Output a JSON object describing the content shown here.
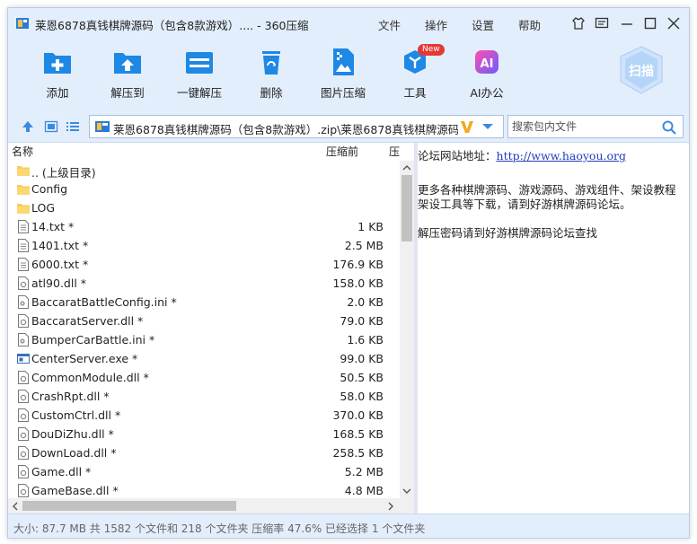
{
  "window": {
    "title": "莱恩6878真钱棋牌源码（包含8款游戏）.... - 360压缩",
    "menu": [
      "文件",
      "操作",
      "设置",
      "帮助"
    ]
  },
  "toolbar": {
    "tools": [
      {
        "label": "添加",
        "icon": "add-icon"
      },
      {
        "label": "解压到",
        "icon": "extract-to-icon"
      },
      {
        "label": "一键解压",
        "icon": "one-click-extract-icon"
      },
      {
        "label": "删除",
        "icon": "delete-icon"
      },
      {
        "label": "图片压缩",
        "icon": "image-compress-icon"
      },
      {
        "label": "工具",
        "icon": "tools-icon",
        "badge": "New"
      },
      {
        "label": "AI办公",
        "icon": "ai-office-icon",
        "glyph": "AI"
      }
    ],
    "scan_label": "扫描"
  },
  "address": {
    "path": "莱恩6878真钱棋牌源码（包含8款游戏）.zip\\莱恩6878真钱棋牌源码（包",
    "search_placeholder": "搜索包内文件"
  },
  "columns": {
    "name": "名称",
    "size_before": "压缩前",
    "ratio": "压"
  },
  "files": [
    {
      "name": ".. (上级目录)",
      "size": "",
      "type": "folder"
    },
    {
      "name": "Config",
      "size": "",
      "type": "folder"
    },
    {
      "name": "LOG",
      "size": "",
      "type": "folder"
    },
    {
      "name": "14.txt *",
      "size": "1 KB",
      "type": "txt"
    },
    {
      "name": "1401.txt *",
      "size": "2.5 MB",
      "type": "txt"
    },
    {
      "name": "6000.txt *",
      "size": "176.9 KB",
      "type": "txt"
    },
    {
      "name": "atl90.dll *",
      "size": "158.0 KB",
      "type": "dll"
    },
    {
      "name": "BaccaratBattleConfig.ini *",
      "size": "2.0 KB",
      "type": "ini"
    },
    {
      "name": "BaccaratServer.dll *",
      "size": "79.0 KB",
      "type": "dll"
    },
    {
      "name": "BumperCarBattle.ini *",
      "size": "1.6 KB",
      "type": "ini"
    },
    {
      "name": "CenterServer.exe *",
      "size": "99.0 KB",
      "type": "exe"
    },
    {
      "name": "CommonModule.dll *",
      "size": "50.5 KB",
      "type": "dll"
    },
    {
      "name": "CrashRpt.dll *",
      "size": "58.0 KB",
      "type": "dll"
    },
    {
      "name": "CustomCtrl.dll *",
      "size": "370.0 KB",
      "type": "dll"
    },
    {
      "name": "DouDiZhu.dll *",
      "size": "168.5 KB",
      "type": "dll"
    },
    {
      "name": "DownLoad.dll *",
      "size": "258.5 KB",
      "type": "dll"
    },
    {
      "name": "Game.dll *",
      "size": "5.2 MB",
      "type": "dll"
    },
    {
      "name": "GameBase.dll *",
      "size": "4.8 MB",
      "type": "dll"
    }
  ],
  "info_panel": {
    "forum_label": "论坛网站地址：",
    "forum_url": "http://www.haoyou.org",
    "line1": "更多各种棋牌源码、游戏源码、游戏组件、架设教程",
    "line2": "架设工具等下载，请到好游棋牌源码论坛。",
    "line3": "解压密码请到好游棋牌源码论坛查找"
  },
  "status": {
    "text": "大小: 87.7 MB 共 1582 个文件和 218 个文件夹 压缩率 47.6% 已经选择 1 个文件夹"
  },
  "colors": {
    "chrome": "#e3eefc",
    "accent": "#1e88e5",
    "badge": "#e53935"
  }
}
